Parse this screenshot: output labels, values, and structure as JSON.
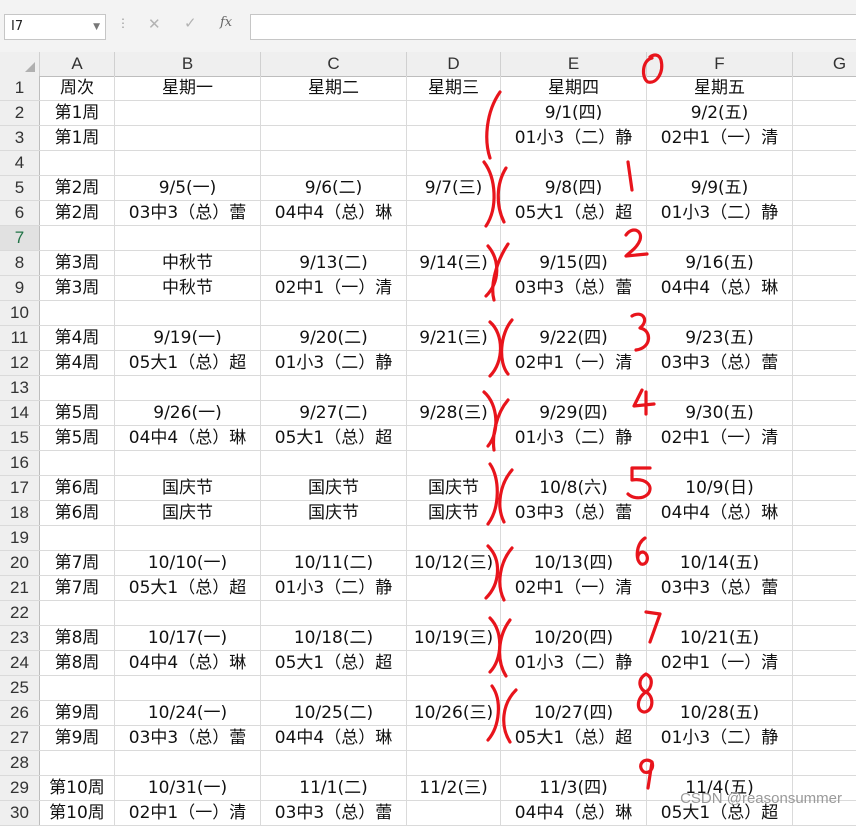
{
  "formula_bar": {
    "name_box": "I7",
    "fx_label": "fx",
    "formula": ""
  },
  "columns": [
    "A",
    "B",
    "C",
    "D",
    "E",
    "F",
    "G"
  ],
  "rows": [
    {
      "n": "1",
      "cells": [
        "周次",
        "星期一",
        "星期二",
        "星期三",
        "星期四",
        "星期五",
        ""
      ]
    },
    {
      "n": "2",
      "cells": [
        "第1周",
        "",
        "",
        "",
        "9/1(四)",
        "9/2(五)",
        ""
      ]
    },
    {
      "n": "3",
      "cells": [
        "第1周",
        "",
        "",
        "",
        "01小3（二）静",
        "02中1（一）清",
        ""
      ]
    },
    {
      "n": "4",
      "cells": [
        "",
        "",
        "",
        "",
        "",
        "",
        ""
      ]
    },
    {
      "n": "5",
      "cells": [
        "第2周",
        "9/5(一)",
        "9/6(二)",
        "9/7(三)",
        "9/8(四)",
        "9/9(五)",
        ""
      ]
    },
    {
      "n": "6",
      "cells": [
        "第2周",
        "03中3（总）蕾",
        "04中4（总）琳",
        "",
        "05大1（总）超",
        "01小3（二）静",
        ""
      ]
    },
    {
      "n": "7",
      "cells": [
        "",
        "",
        "",
        "",
        "",
        "",
        ""
      ]
    },
    {
      "n": "8",
      "cells": [
        "第3周",
        "中秋节",
        "9/13(二)",
        "9/14(三)",
        "9/15(四)",
        "9/16(五)",
        ""
      ]
    },
    {
      "n": "9",
      "cells": [
        "第3周",
        "中秋节",
        "02中1（一）清",
        "",
        "03中3（总）蕾",
        "04中4（总）琳",
        ""
      ]
    },
    {
      "n": "10",
      "cells": [
        "",
        "",
        "",
        "",
        "",
        "",
        ""
      ]
    },
    {
      "n": "11",
      "cells": [
        "第4周",
        "9/19(一)",
        "9/20(二)",
        "9/21(三)",
        "9/22(四)",
        "9/23(五)",
        ""
      ]
    },
    {
      "n": "12",
      "cells": [
        "第4周",
        "05大1（总）超",
        "01小3（二）静",
        "",
        "02中1（一）清",
        "03中3（总）蕾",
        ""
      ]
    },
    {
      "n": "13",
      "cells": [
        "",
        "",
        "",
        "",
        "",
        "",
        ""
      ]
    },
    {
      "n": "14",
      "cells": [
        "第5周",
        "9/26(一)",
        "9/27(二)",
        "9/28(三)",
        "9/29(四)",
        "9/30(五)",
        ""
      ]
    },
    {
      "n": "15",
      "cells": [
        "第5周",
        "04中4（总）琳",
        "05大1（总）超",
        "",
        "01小3（二）静",
        "02中1（一）清",
        ""
      ]
    },
    {
      "n": "16",
      "cells": [
        "",
        "",
        "",
        "",
        "",
        "",
        ""
      ]
    },
    {
      "n": "17",
      "cells": [
        "第6周",
        "国庆节",
        "国庆节",
        "国庆节",
        "10/8(六)",
        "10/9(日)",
        ""
      ]
    },
    {
      "n": "18",
      "cells": [
        "第6周",
        "国庆节",
        "国庆节",
        "国庆节",
        "03中3（总）蕾",
        "04中4（总）琳",
        ""
      ]
    },
    {
      "n": "19",
      "cells": [
        "",
        "",
        "",
        "",
        "",
        "",
        ""
      ]
    },
    {
      "n": "20",
      "cells": [
        "第7周",
        "10/10(一)",
        "10/11(二)",
        "10/12(三)",
        "10/13(四)",
        "10/14(五)",
        ""
      ]
    },
    {
      "n": "21",
      "cells": [
        "第7周",
        "05大1（总）超",
        "01小3（二）静",
        "",
        "02中1（一）清",
        "03中3（总）蕾",
        ""
      ]
    },
    {
      "n": "22",
      "cells": [
        "",
        "",
        "",
        "",
        "",
        "",
        ""
      ]
    },
    {
      "n": "23",
      "cells": [
        "第8周",
        "10/17(一)",
        "10/18(二)",
        "10/19(三)",
        "10/20(四)",
        "10/21(五)",
        ""
      ]
    },
    {
      "n": "24",
      "cells": [
        "第8周",
        "04中4（总）琳",
        "05大1（总）超",
        "",
        "01小3（二）静",
        "02中1（一）清",
        ""
      ]
    },
    {
      "n": "25",
      "cells": [
        "",
        "",
        "",
        "",
        "",
        "",
        ""
      ]
    },
    {
      "n": "26",
      "cells": [
        "第9周",
        "10/24(一)",
        "10/25(二)",
        "10/26(三)",
        "10/27(四)",
        "10/28(五)",
        ""
      ]
    },
    {
      "n": "27",
      "cells": [
        "第9周",
        "03中3（总）蕾",
        "04中4（总）琳",
        "",
        "05大1（总）超",
        "01小3（二）静",
        ""
      ]
    },
    {
      "n": "28",
      "cells": [
        "",
        "",
        "",
        "",
        "",
        "",
        ""
      ]
    },
    {
      "n": "29",
      "cells": [
        "第10周",
        "10/31(一)",
        "11/1(二)",
        "11/2(三)",
        "11/3(四)",
        "11/4(五)",
        ""
      ]
    },
    {
      "n": "30",
      "cells": [
        "第10周",
        "02中1（一）清",
        "03中3（总）蕾",
        "",
        "04中4（总）琳",
        "05大1（总）超",
        ""
      ]
    }
  ],
  "selected_row": "7",
  "annotation_digits": [
    "0",
    "1",
    "2",
    "3",
    "4",
    "5",
    "6",
    "7",
    "8",
    "9"
  ],
  "watermark": "CSDN @reasonsummer",
  "colors": {
    "ink": "#e8141c",
    "header_bg": "#efefef",
    "selected_header": "#217346"
  }
}
